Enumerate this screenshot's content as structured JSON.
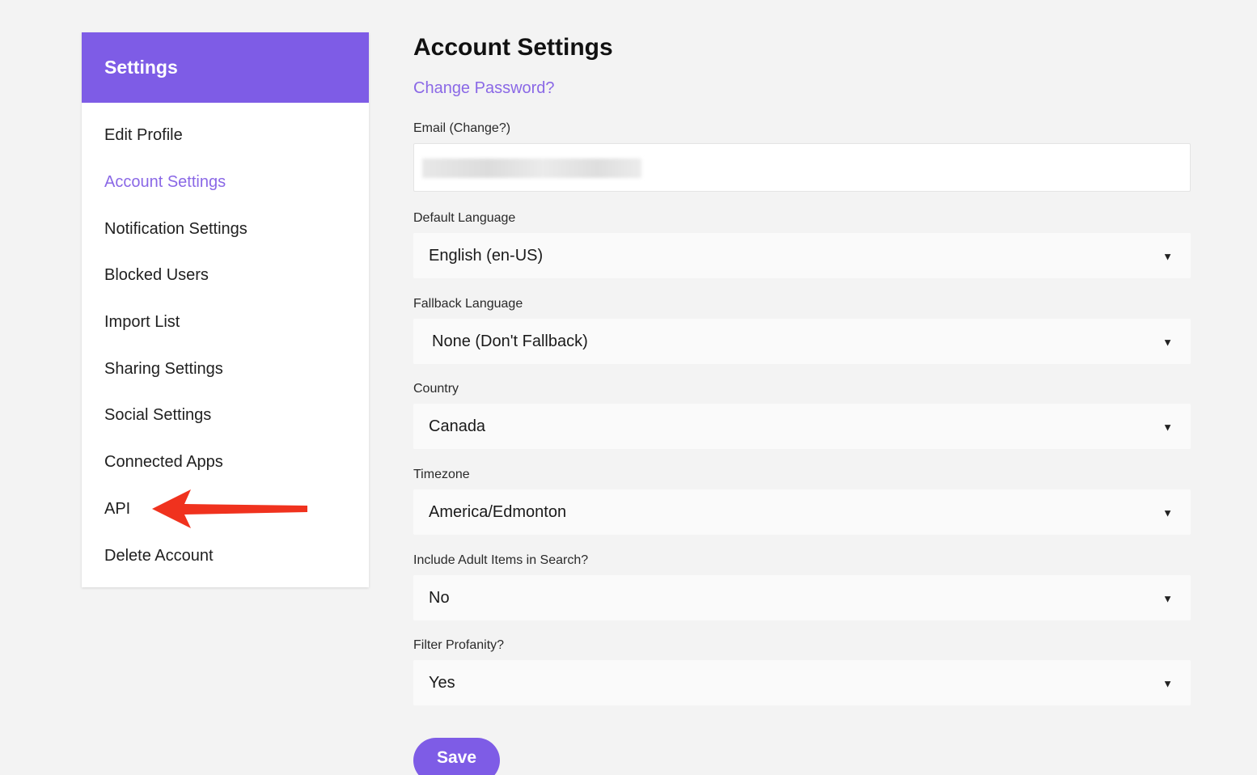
{
  "sidebar": {
    "title": "Settings",
    "items": [
      {
        "label": "Edit Profile"
      },
      {
        "label": "Account Settings",
        "active": true
      },
      {
        "label": "Notification Settings"
      },
      {
        "label": "Blocked Users"
      },
      {
        "label": "Import List"
      },
      {
        "label": "Sharing Settings"
      },
      {
        "label": "Social Settings"
      },
      {
        "label": "Connected Apps"
      },
      {
        "label": "API"
      },
      {
        "label": "Delete Account"
      }
    ]
  },
  "main": {
    "title": "Account Settings",
    "change_password": "Change Password?",
    "email": {
      "label_prefix": "Email (",
      "change_link": "Change?",
      "label_suffix": ")",
      "value": ""
    },
    "fields": [
      {
        "label": "Default Language",
        "value": "English (en-US)"
      },
      {
        "label": "Fallback Language",
        "value": "None (Don't Fallback)"
      },
      {
        "label": "Country",
        "value": "Canada"
      },
      {
        "label": "Timezone",
        "value": "America/Edmonton"
      },
      {
        "label": "Include Adult Items in Search?",
        "value": "No"
      },
      {
        "label": "Filter Profanity?",
        "value": "Yes"
      }
    ],
    "save_label": "Save"
  },
  "icons": {
    "dropdown": "caret-down-icon",
    "annotation": "red-arrow-icon"
  },
  "colors": {
    "accent": "#7e5ce6",
    "link": "#8a68e6",
    "annotation_arrow": "#f0321e"
  }
}
